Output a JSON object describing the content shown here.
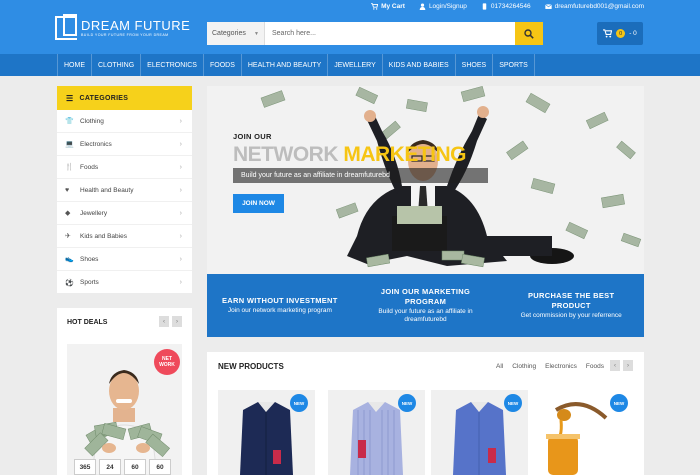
{
  "topbar": {
    "links": [
      {
        "icon": "cart-icon",
        "label": "My Cart"
      },
      {
        "icon": "user-icon",
        "label": "Login/Signup"
      },
      {
        "icon": "phone-icon",
        "label": "01734264546"
      },
      {
        "icon": "mail-icon",
        "label": "dreamfuturebd001@gmail.com"
      }
    ]
  },
  "logo": {
    "title": "DREAM FUTURE",
    "tagline": "BUILD YOUR FUTURE FROM YOUR DREAM"
  },
  "search": {
    "category": "Categories",
    "placeholder": "Search here..."
  },
  "cart": {
    "count": "0",
    "total": "- 0"
  },
  "nav": {
    "items": [
      "HOME",
      "CLOTHING",
      "ELECTRONICS",
      "FOODS",
      "HEALTH AND BEAUTY",
      "JEWELLERY",
      "KIDS AND BABIES",
      "SHOES",
      "SPORTS"
    ]
  },
  "sidebar": {
    "title": "CATEGORIES",
    "items": [
      {
        "icon": "shirt-icon",
        "label": "Clothing"
      },
      {
        "icon": "laptop-icon",
        "label": "Electronics"
      },
      {
        "icon": "cutlery-icon",
        "label": "Foods"
      },
      {
        "icon": "heart-icon",
        "label": "Health and Beauty"
      },
      {
        "icon": "diamond-icon",
        "label": "Jewellery"
      },
      {
        "icon": "plane-icon",
        "label": "Kids and Babies"
      },
      {
        "icon": "shoe-icon",
        "label": "Shoes"
      },
      {
        "icon": "ball-icon",
        "label": "Sports"
      }
    ]
  },
  "hotdeals": {
    "title": "HOT DEALS",
    "badge_line1": "NET",
    "badge_line2": "WORK",
    "countdown": [
      "365",
      "24",
      "60",
      "60"
    ]
  },
  "banner": {
    "join_label": "JOIN OUR",
    "title_part1": "NETWORK",
    "title_part2": "MARKETING",
    "subtitle": "Build your future as an affiliate in dreamfuturebd",
    "button": "JOIN NOW"
  },
  "features": [
    {
      "title": "EARN WITHOUT INVESTMENT",
      "desc": "Join our network marketing program"
    },
    {
      "title": "JOIN OUR MARKETING PROGRAM",
      "desc": "Build your future as an affiliate in dreamfuturebd"
    },
    {
      "title": "PURCHASE THE BEST PRODUCT",
      "desc": "Get commission by your referrence"
    }
  ],
  "new_products": {
    "title": "NEW PRODUCTS",
    "tabs": [
      "All",
      "Clothing",
      "Electronics",
      "Foods"
    ],
    "badge": "NEW"
  },
  "colors": {
    "primary": "#2f8de4",
    "nav": "#1e75c7",
    "accent": "#f6c514",
    "badge_red": "#ef4a5b"
  }
}
